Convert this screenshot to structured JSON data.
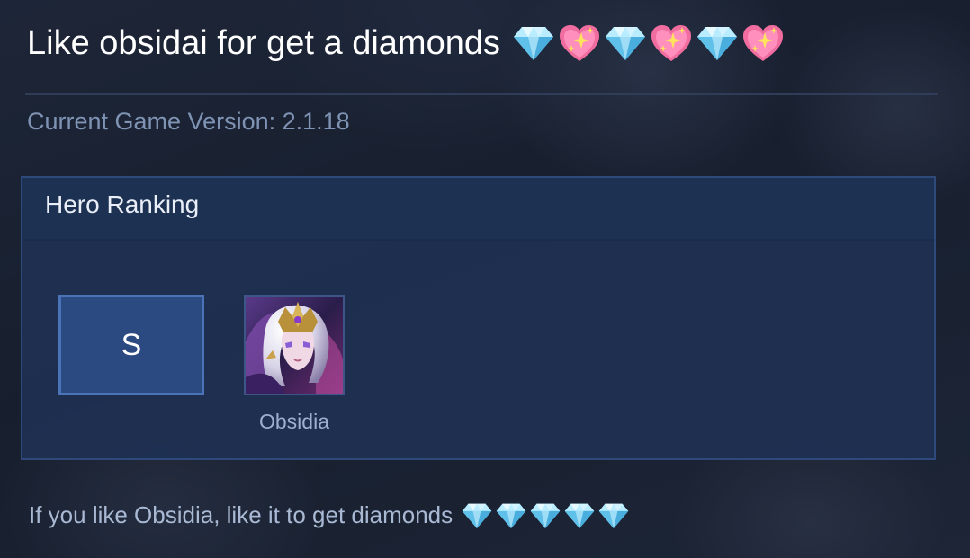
{
  "header": {
    "title": "Like obsidai for get a diamonds",
    "emoji_icons": [
      "gem-icon",
      "sparkling-heart-icon",
      "gem-icon",
      "sparkling-heart-icon",
      "gem-icon",
      "sparkling-heart-icon"
    ]
  },
  "version": {
    "label": "Current Game Version: 2.1.18"
  },
  "ranking": {
    "title": "Hero Ranking",
    "tier": "S",
    "hero": {
      "name": "Obsidia",
      "portrait_icon": "obsidia-portrait"
    }
  },
  "footer": {
    "text": "If you like Obsidia, like it to get diamonds",
    "emoji_icons": [
      "gem-icon",
      "gem-icon",
      "gem-icon",
      "gem-icon",
      "gem-icon"
    ]
  },
  "colors": {
    "background": "#1c2436",
    "panel": "#1f3154",
    "tier_box": "#2c4a82",
    "tier_border": "#4a73b8",
    "muted_text": "#7f93b4"
  }
}
